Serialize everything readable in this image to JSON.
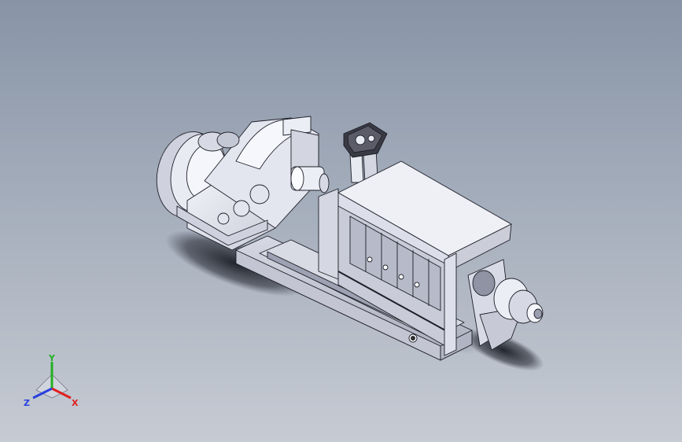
{
  "viewport": {
    "background_top": "#8894a6",
    "background_bottom": "#c6cbd3"
  },
  "model": {
    "icon": "oil-press-assembly-icon",
    "part_color": "#e6e8f2",
    "edge_color": "#1e1e28"
  },
  "triad": {
    "x_label": "X",
    "y_label": "Y",
    "z_label": "Z",
    "x_color": "#e02020",
    "y_color": "#22b022",
    "z_color": "#2a40e0"
  }
}
